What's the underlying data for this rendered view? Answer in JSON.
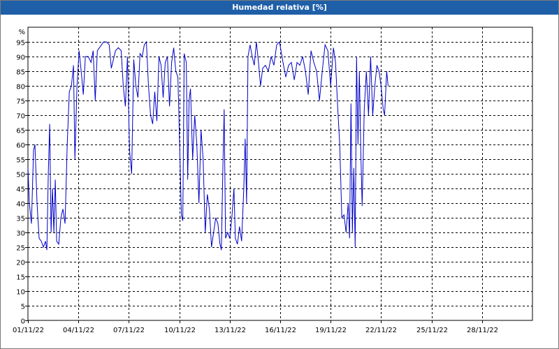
{
  "window": {
    "title": "Humedad relativa [%]"
  },
  "chart_data": {
    "type": "line",
    "title": "Humedad relativa [%]",
    "ylabel": "%",
    "xlabel": "",
    "ylim": [
      0,
      100
    ],
    "xlim": [
      "2022-11-01",
      "2022-12-01"
    ],
    "yticks": [
      0,
      5,
      10,
      15,
      20,
      25,
      30,
      35,
      40,
      45,
      50,
      55,
      60,
      65,
      70,
      75,
      80,
      85,
      90,
      95
    ],
    "xticks": [
      "01/11/22",
      "04/11/22",
      "07/11/22",
      "10/11/22",
      "13/11/22",
      "16/11/22",
      "19/11/22",
      "22/11/22",
      "25/11/22",
      "28/11/22"
    ],
    "grid": true,
    "grid_style": "dashed",
    "line_color": "#0000c8",
    "series": [
      {
        "values": [
          [
            "2022-11-01 00:00",
            52
          ],
          [
            "2022-11-01 02:00",
            40
          ],
          [
            "2022-11-01 05:00",
            33
          ],
          [
            "2022-11-01 08:00",
            58
          ],
          [
            "2022-11-01 10:00",
            60
          ],
          [
            "2022-11-01 13:00",
            40
          ],
          [
            "2022-11-01 16:00",
            28
          ],
          [
            "2022-11-01 19:00",
            27
          ],
          [
            "2022-11-01 22:00",
            25
          ],
          [
            "2022-11-02 01:00",
            27
          ],
          [
            "2022-11-02 03:00",
            24
          ],
          [
            "2022-11-02 05:00",
            50
          ],
          [
            "2022-11-02 07:00",
            67
          ],
          [
            "2022-11-02 09:00",
            30
          ],
          [
            "2022-11-02 11:00",
            45
          ],
          [
            "2022-11-02 13:00",
            30
          ],
          [
            "2022-11-02 15:00",
            48
          ],
          [
            "2022-11-02 17:00",
            27
          ],
          [
            "2022-11-02 20:00",
            26
          ],
          [
            "2022-11-02 23:00",
            35
          ],
          [
            "2022-11-03 02:00",
            38
          ],
          [
            "2022-11-03 05:00",
            33
          ],
          [
            "2022-11-03 08:00",
            60
          ],
          [
            "2022-11-03 11:00",
            78
          ],
          [
            "2022-11-03 14:00",
            80
          ],
          [
            "2022-11-03 17:00",
            87
          ],
          [
            "2022-11-03 19:00",
            55
          ],
          [
            "2022-11-03 22:00",
            80
          ],
          [
            "2022-11-04 01:00",
            92
          ],
          [
            "2022-11-04 04:00",
            85
          ],
          [
            "2022-11-04 07:00",
            77
          ],
          [
            "2022-11-04 10:00",
            90
          ],
          [
            "2022-11-04 14:00",
            90
          ],
          [
            "2022-11-04 18:00",
            88
          ],
          [
            "2022-11-04 21:00",
            92
          ],
          [
            "2022-11-05 00:00",
            75
          ],
          [
            "2022-11-05 03:00",
            92
          ],
          [
            "2022-11-05 06:00",
            93
          ],
          [
            "2022-11-05 09:00",
            94
          ],
          [
            "2022-11-05 12:00",
            95
          ],
          [
            "2022-11-05 16:00",
            95
          ],
          [
            "2022-11-05 20:00",
            94
          ],
          [
            "2022-11-05 23:00",
            86
          ],
          [
            "2022-11-06 02:00",
            89
          ],
          [
            "2022-11-06 05:00",
            92
          ],
          [
            "2022-11-06 09:00",
            93
          ],
          [
            "2022-11-06 13:00",
            92
          ],
          [
            "2022-11-06 16:00",
            80
          ],
          [
            "2022-11-06 19:00",
            73
          ],
          [
            "2022-11-06 22:00",
            90
          ],
          [
            "2022-11-07 01:00",
            58
          ],
          [
            "2022-11-07 04:00",
            50
          ],
          [
            "2022-11-07 07:00",
            89
          ],
          [
            "2022-11-07 10:00",
            80
          ],
          [
            "2022-11-07 13:00",
            76
          ],
          [
            "2022-11-07 16:00",
            91
          ],
          [
            "2022-11-07 19:00",
            90
          ],
          [
            "2022-11-07 22:00",
            94
          ],
          [
            "2022-11-08 01:00",
            95
          ],
          [
            "2022-11-08 04:00",
            80
          ],
          [
            "2022-11-08 07:00",
            70
          ],
          [
            "2022-11-08 10:00",
            67
          ],
          [
            "2022-11-08 13:00",
            78
          ],
          [
            "2022-11-08 16:00",
            68
          ],
          [
            "2022-11-08 19:00",
            90
          ],
          [
            "2022-11-08 22:00",
            87
          ],
          [
            "2022-11-09 01:00",
            76
          ],
          [
            "2022-11-09 04:00",
            88
          ],
          [
            "2022-11-09 07:00",
            90
          ],
          [
            "2022-11-09 10:00",
            73
          ],
          [
            "2022-11-09 13:00",
            88
          ],
          [
            "2022-11-09 16:00",
            93
          ],
          [
            "2022-11-09 19:00",
            85
          ],
          [
            "2022-11-09 22:00",
            83
          ],
          [
            "2022-11-10 01:00",
            55
          ],
          [
            "2022-11-10 03:00",
            36
          ],
          [
            "2022-11-10 05:00",
            34
          ],
          [
            "2022-11-10 07:00",
            91
          ],
          [
            "2022-11-10 10:00",
            88
          ],
          [
            "2022-11-10 12:00",
            48
          ],
          [
            "2022-11-10 14:00",
            75
          ],
          [
            "2022-11-10 16:00",
            79
          ],
          [
            "2022-11-10 19:00",
            55
          ],
          [
            "2022-11-10 22:00",
            70
          ],
          [
            "2022-11-11 01:00",
            60
          ],
          [
            "2022-11-11 04:00",
            40
          ],
          [
            "2022-11-11 07:00",
            65
          ],
          [
            "2022-11-11 10:00",
            55
          ],
          [
            "2022-11-11 13:00",
            30
          ],
          [
            "2022-11-11 16:00",
            43
          ],
          [
            "2022-11-11 19:00",
            38
          ],
          [
            "2022-11-11 22:00",
            25
          ],
          [
            "2022-11-12 01:00",
            30
          ],
          [
            "2022-11-12 04:00",
            35
          ],
          [
            "2022-11-12 07:00",
            33
          ],
          [
            "2022-11-12 10:00",
            26
          ],
          [
            "2022-11-12 12:00",
            24
          ],
          [
            "2022-11-12 14:00",
            50
          ],
          [
            "2022-11-12 16:00",
            72
          ],
          [
            "2022-11-12 18:00",
            28
          ],
          [
            "2022-11-12 21:00",
            30
          ],
          [
            "2022-11-13 00:00",
            28
          ],
          [
            "2022-11-13 03:00",
            35
          ],
          [
            "2022-11-13 06:00",
            45
          ],
          [
            "2022-11-13 08:00",
            28
          ],
          [
            "2022-11-13 11:00",
            26
          ],
          [
            "2022-11-13 14:00",
            32
          ],
          [
            "2022-11-13 17:00",
            27
          ],
          [
            "2022-11-13 20:00",
            45
          ],
          [
            "2022-11-13 22:00",
            62
          ],
          [
            "2022-11-14 00:00",
            40
          ],
          [
            "2022-11-14 02:00",
            90
          ],
          [
            "2022-11-14 05:00",
            94
          ],
          [
            "2022-11-14 08:00",
            90
          ],
          [
            "2022-11-14 11:00",
            87
          ],
          [
            "2022-11-14 14:00",
            95
          ],
          [
            "2022-11-14 17:00",
            88
          ],
          [
            "2022-11-14 20:00",
            80
          ],
          [
            "2022-11-14 23:00",
            86
          ],
          [
            "2022-11-15 03:00",
            87
          ],
          [
            "2022-11-15 07:00",
            85
          ],
          [
            "2022-11-15 11:00",
            90
          ],
          [
            "2022-11-15 15:00",
            87
          ],
          [
            "2022-11-15 19:00",
            94
          ],
          [
            "2022-11-15 23:00",
            95
          ],
          [
            "2022-11-16 04:00",
            88
          ],
          [
            "2022-11-16 08:00",
            83
          ],
          [
            "2022-11-16 12:00",
            87
          ],
          [
            "2022-11-16 16:00",
            88
          ],
          [
            "2022-11-16 20:00",
            82
          ],
          [
            "2022-11-17 00:00",
            88
          ],
          [
            "2022-11-17 04:00",
            87
          ],
          [
            "2022-11-17 08:00",
            90
          ],
          [
            "2022-11-17 12:00",
            85
          ],
          [
            "2022-11-17 16:00",
            77
          ],
          [
            "2022-11-17 20:00",
            92
          ],
          [
            "2022-11-18 00:00",
            88
          ],
          [
            "2022-11-18 04:00",
            85
          ],
          [
            "2022-11-18 08:00",
            75
          ],
          [
            "2022-11-18 12:00",
            85
          ],
          [
            "2022-11-18 16:00",
            94
          ],
          [
            "2022-11-18 20:00",
            92
          ],
          [
            "2022-11-19 00:00",
            80
          ],
          [
            "2022-11-19 04:00",
            93
          ],
          [
            "2022-11-19 07:00",
            88
          ],
          [
            "2022-11-19 10:00",
            73
          ],
          [
            "2022-11-19 13:00",
            60
          ],
          [
            "2022-11-19 16:00",
            35
          ],
          [
            "2022-11-19 19:00",
            36
          ],
          [
            "2022-11-19 22:00",
            30
          ],
          [
            "2022-11-20 01:00",
            40
          ],
          [
            "2022-11-20 03:00",
            28
          ],
          [
            "2022-11-20 05:00",
            74
          ],
          [
            "2022-11-20 07:00",
            30
          ],
          [
            "2022-11-20 09:00",
            52
          ],
          [
            "2022-11-20 11:00",
            25
          ],
          [
            "2022-11-20 13:00",
            90
          ],
          [
            "2022-11-20 15:00",
            60
          ],
          [
            "2022-11-20 17:00",
            85
          ],
          [
            "2022-11-20 19:00",
            58
          ],
          [
            "2022-11-20 21:00",
            39
          ],
          [
            "2022-11-21 00:00",
            72
          ],
          [
            "2022-11-21 03:00",
            85
          ],
          [
            "2022-11-21 06:00",
            70
          ],
          [
            "2022-11-21 09:00",
            90
          ],
          [
            "2022-11-21 12:00",
            70
          ],
          [
            "2022-11-21 15:00",
            80
          ],
          [
            "2022-11-21 18:00",
            87
          ],
          [
            "2022-11-21 21:00",
            85
          ],
          [
            "2022-11-22 00:00",
            80
          ],
          [
            "2022-11-22 03:00",
            72
          ],
          [
            "2022-11-22 05:00",
            70
          ],
          [
            "2022-11-22 08:00",
            85
          ],
          [
            "2022-11-22 10:00",
            80
          ]
        ]
      }
    ]
  }
}
